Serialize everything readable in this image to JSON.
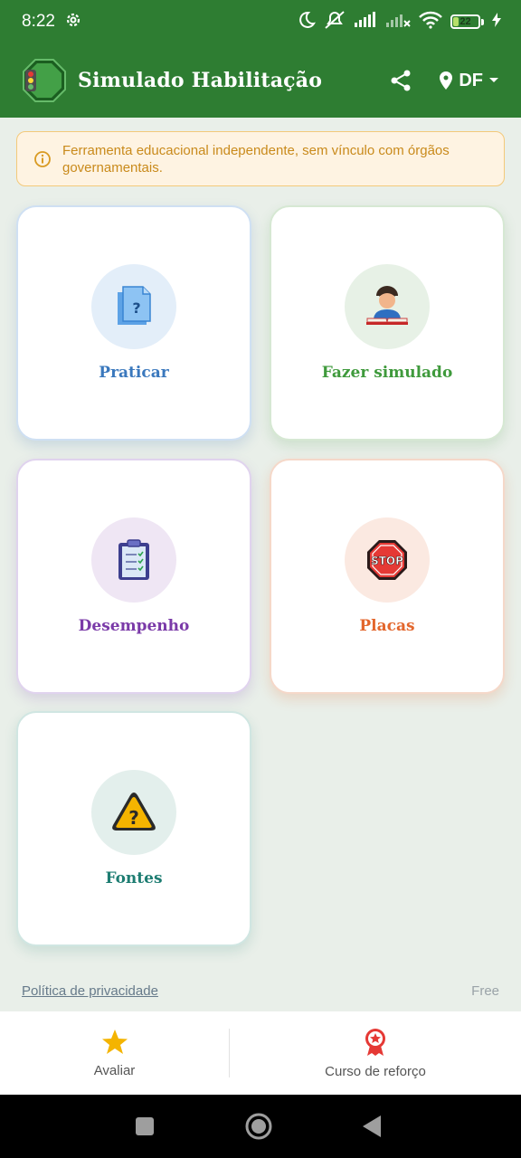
{
  "status_bar": {
    "time": "8:22",
    "battery_level": "22",
    "icons": [
      "gear-icon",
      "moon-icon",
      "alarm-off-icon",
      "signal-icon",
      "signal-off-icon",
      "wifi-icon",
      "battery-icon",
      "charging-icon"
    ]
  },
  "app_bar": {
    "title": "Simulado Habilitação",
    "logo_icon": "traffic-light-icon",
    "share_icon": "share-icon",
    "state_icon": "location-pin-icon",
    "state": "DF"
  },
  "notice": {
    "icon": "info-icon",
    "text": "Ferramenta educacional independente, sem vínculo com órgãos governamentais."
  },
  "cards": [
    {
      "label": "Praticar",
      "icon": "question-document-icon",
      "color": "#3a78bd"
    },
    {
      "label": "Fazer simulado",
      "icon": "student-reading-icon",
      "color": "#3f9a3c"
    },
    {
      "label": "Desempenho",
      "icon": "clipboard-check-icon",
      "color": "#7a3aa8"
    },
    {
      "label": "Placas",
      "icon": "stop-sign-icon",
      "color": "#e3662c"
    },
    {
      "label": "Fontes",
      "icon": "warning-question-icon",
      "color": "#1e7d72"
    }
  ],
  "footer": {
    "privacy_link": "Política de privacidade",
    "version": "Free"
  },
  "bottom_nav": {
    "rate_label": "Avaliar",
    "rate_icon": "star-icon",
    "course_label": "Curso de reforço",
    "course_icon": "award-icon"
  },
  "colors": {
    "primary": "#2e7d32",
    "background": "#e9efe9",
    "notice_bg": "#fef3e2",
    "notice_text": "#c98a1b",
    "star": "#f4b400",
    "award": "#e53935"
  }
}
